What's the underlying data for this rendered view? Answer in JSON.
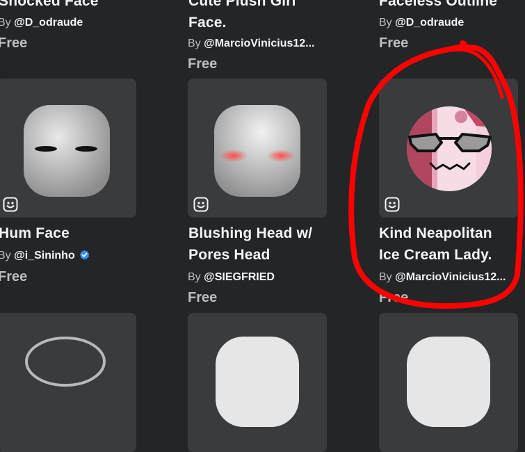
{
  "row_top": [
    {
      "title": "Shocked Face",
      "by": "By",
      "creator": "@D_odraude",
      "price": "Free"
    },
    {
      "title_line1": "Cute Plush Girl",
      "title_line2": "Face.",
      "by": "By",
      "creator": "@MarcioVinicius12...",
      "price": "Free"
    },
    {
      "title": "Faceless Outline",
      "by": "By",
      "creator": "@D_odraude",
      "price": "Free"
    }
  ],
  "row_middle": [
    {
      "title": "Hum Face",
      "by": "By",
      "creator": "@i_Sininho",
      "price": "Free",
      "verified": true
    },
    {
      "title_line1": "Blushing Head w/",
      "title_line2": "Pores Head",
      "by": "By",
      "creator": "@SIEGFRIED",
      "price": "Free"
    },
    {
      "title_line1": "Kind Neapolitan",
      "title_line2": "Ice Cream Lady.",
      "by": "By",
      "creator": "@MarcioVinicius12...",
      "price": "Free"
    }
  ],
  "icons": {
    "face_badge": "face-badge-icon",
    "verified": "verified-badge-icon"
  },
  "colors": {
    "background": "#232527",
    "card": "#393b3d",
    "text": "#f2f4f5",
    "muted": "#bdbebe",
    "annotation": "#ff0000",
    "verified": "#3b8cff"
  }
}
